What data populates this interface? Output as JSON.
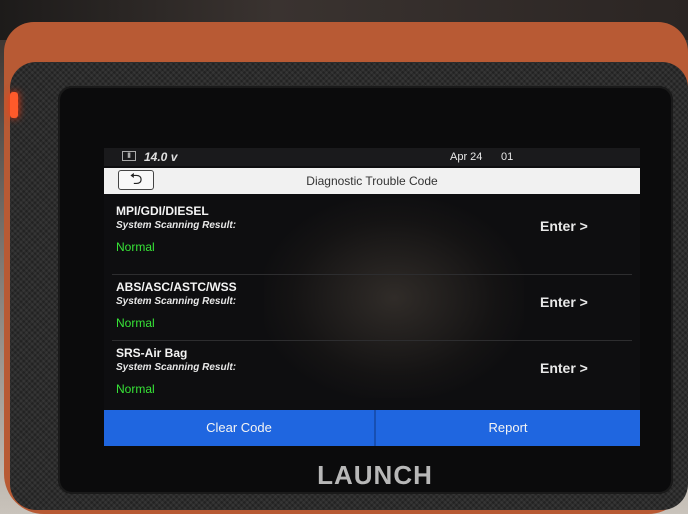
{
  "status_bar": {
    "battery_icon": "battery-icon",
    "voltage": "14.0 v",
    "date": "Apr 24",
    "time": "01"
  },
  "header": {
    "back_icon": "back-arrow-icon",
    "back_glyph": "⮌",
    "title": "Diagnostic Trouble Code"
  },
  "systems": [
    {
      "name": "MPI/GDI/DIESEL",
      "label": "System Scanning Result:",
      "status": "Normal",
      "action": "Enter >"
    },
    {
      "name": "ABS/ASC/ASTC/WSS",
      "label": "System Scanning Result:",
      "status": "Normal",
      "action": "Enter >"
    },
    {
      "name": "SRS-Air Bag",
      "label": "System Scanning Result:",
      "status": "Normal",
      "action": "Enter >"
    }
  ],
  "footer": {
    "clear_code": "Clear Code",
    "report": "Report"
  },
  "device": {
    "brand": "LAUNCH"
  },
  "colors": {
    "accent_blue": "#1f66e0",
    "status_normal": "#37e437",
    "bumper_orange": "#b85a34"
  }
}
